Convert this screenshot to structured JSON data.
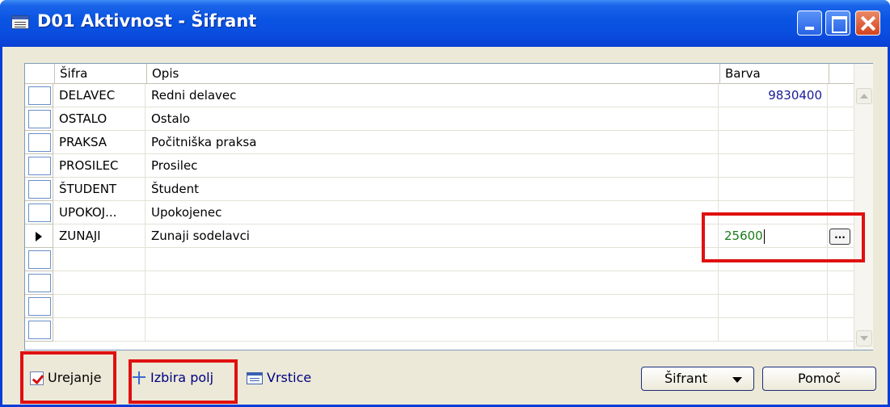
{
  "window": {
    "title": "D01 Aktivnost - Šifrant"
  },
  "grid": {
    "headers": {
      "code": "Šifra",
      "description": "Opis",
      "color": "Barva"
    },
    "rows": [
      {
        "code": "DELAVEC",
        "description": "Redni delavec",
        "color": "9830400"
      },
      {
        "code": "OSTALO",
        "description": "Ostalo",
        "color": ""
      },
      {
        "code": "PRAKSA",
        "description": "Počitniška praksa",
        "color": ""
      },
      {
        "code": "PROSILEC",
        "description": "Prosilec",
        "color": ""
      },
      {
        "code": "ŠTUDENT",
        "description": "Študent",
        "color": ""
      },
      {
        "code": "UPOKOJ...",
        "description": "Upokojenec",
        "color": ""
      },
      {
        "code": "ZUNAJI",
        "description": "Zunaji sodelavci",
        "color": "25600"
      }
    ],
    "active_row_index": 6,
    "ellipsis_label": "..."
  },
  "footer": {
    "edit_label": "Urejanje",
    "field_select_label": "Izbira polj",
    "rows_label": "Vrstice",
    "sifrant_label": "Šifrant",
    "help_label": "Pomoč"
  },
  "colors": {
    "highlight_red": "#e01010",
    "title_blue": "#0a4ee0",
    "active_value_green": "#1a7a1a",
    "value_blue": "#1a1a9a"
  }
}
